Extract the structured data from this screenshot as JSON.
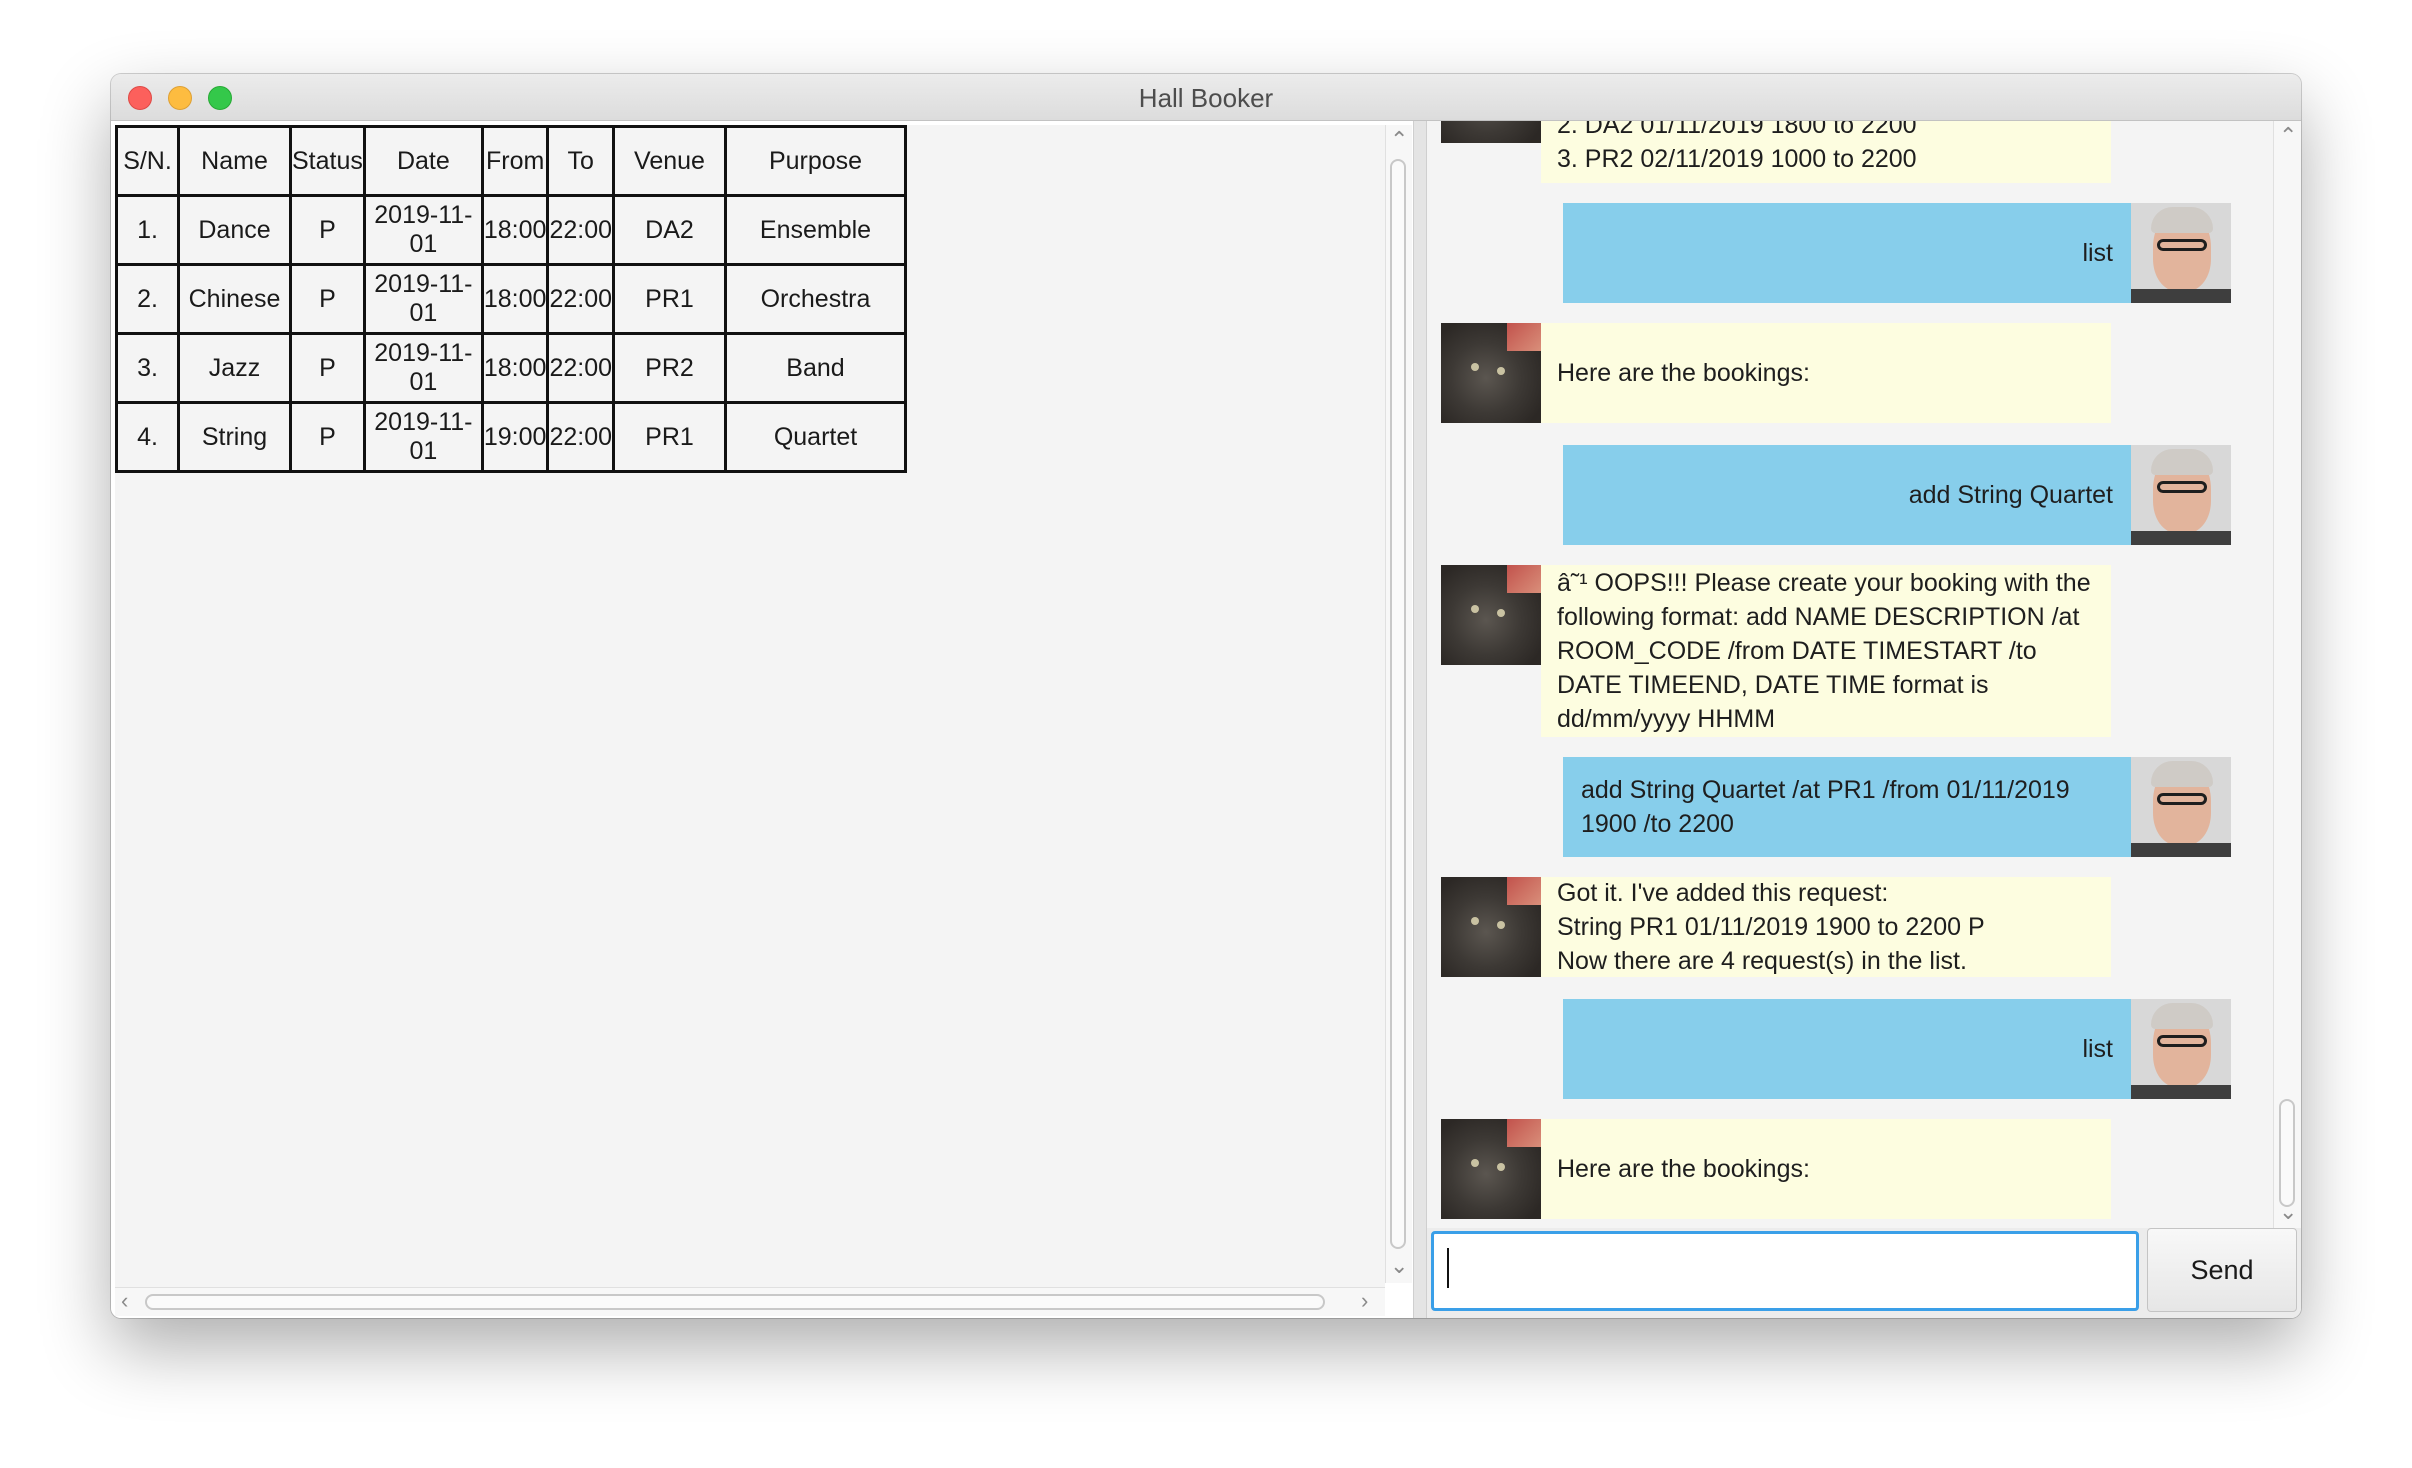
{
  "window": {
    "title": "Hall Booker"
  },
  "table": {
    "columns": [
      "S/N.",
      "Name",
      "Status",
      "Date",
      "From",
      "To",
      "Venue",
      "Purpose"
    ],
    "rows": [
      [
        "1.",
        "Dance",
        "P",
        "2019-11-01",
        "18:00",
        "22:00",
        "DA2",
        "Ensemble"
      ],
      [
        "2.",
        "Chinese",
        "P",
        "2019-11-01",
        "18:00",
        "22:00",
        "PR1",
        "Orchestra"
      ],
      [
        "3.",
        "Jazz",
        "P",
        "2019-11-01",
        "18:00",
        "22:00",
        "PR2",
        "Band"
      ],
      [
        "4.",
        "String",
        "P",
        "2019-11-01",
        "19:00",
        "22:00",
        "PR1",
        "Quartet"
      ]
    ]
  },
  "chat": {
    "messages": [
      {
        "sender": "bot",
        "text": "2. DA2 01/11/2019 1800 to 2200\n3. PR2 02/11/2019 1000 to 2200"
      },
      {
        "sender": "user",
        "text": "list"
      },
      {
        "sender": "bot",
        "text": "Here are the bookings:"
      },
      {
        "sender": "user",
        "text": "add String Quartet"
      },
      {
        "sender": "bot",
        "text": "â˜¹ OOPS!!! Please create your booking with the following format: add NAME DESCRIPTION /at ROOM_CODE /from DATE TIMESTART /to DATE TIMEEND, DATE TIME format is dd/mm/yyyy HHMM"
      },
      {
        "sender": "user",
        "text": "add String Quartet /at PR1 /from 01/11/2019 1900 /to 2200"
      },
      {
        "sender": "bot",
        "text": "Got it. I've added this request:\nString PR1 01/11/2019 1900 to 2200 P\nNow there are 4 request(s) in the list."
      },
      {
        "sender": "user",
        "text": "list"
      },
      {
        "sender": "bot",
        "text": "Here are the bookings:"
      }
    ]
  },
  "input": {
    "value": "",
    "placeholder": ""
  },
  "send": {
    "label": "Send"
  }
}
